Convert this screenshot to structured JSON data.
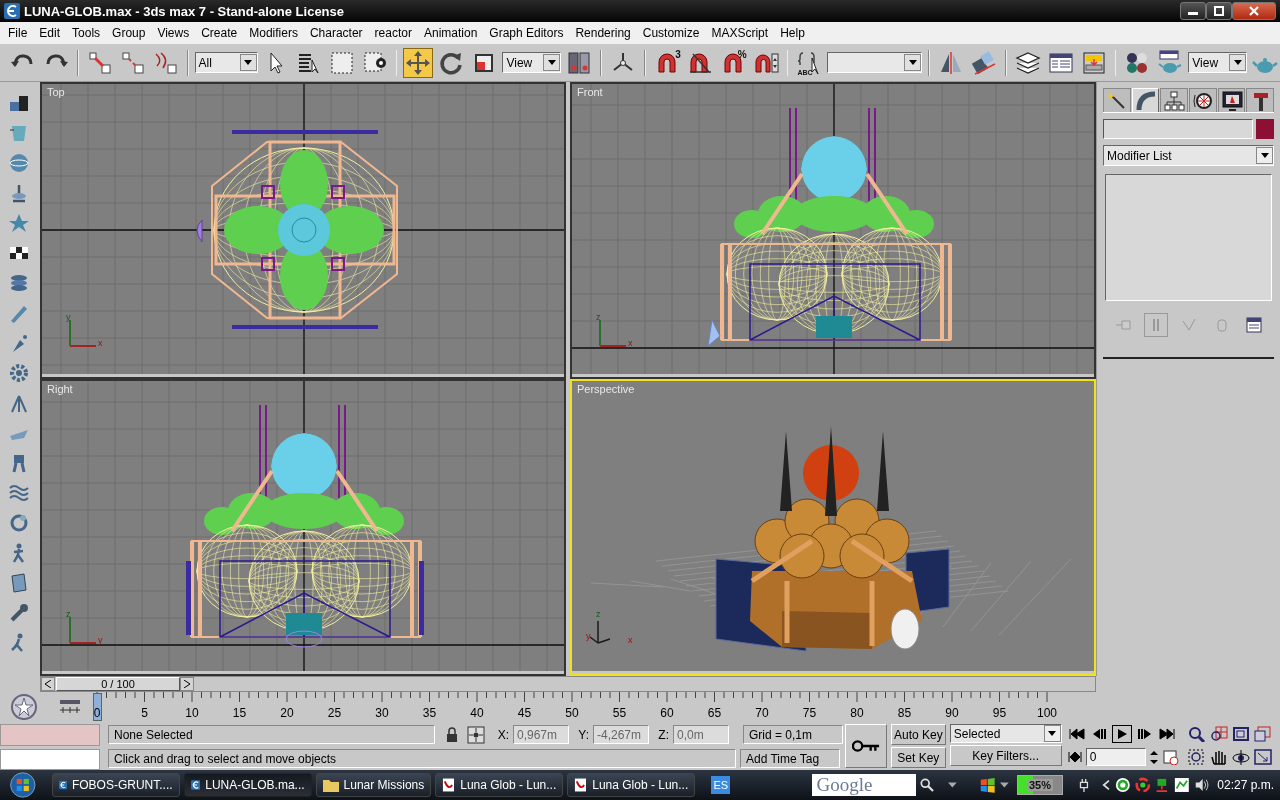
{
  "window": {
    "title": "LUNA-GLOB.max - 3ds max 7  - Stand-alone License"
  },
  "menu": [
    "File",
    "Edit",
    "Tools",
    "Group",
    "Views",
    "Create",
    "Modifiers",
    "Character",
    "reactor",
    "Animation",
    "Graph Editors",
    "Rendering",
    "Customize",
    "MAXScript",
    "Help"
  ],
  "main_toolbar": {
    "buttons": [
      {
        "selected": false
      },
      {
        "selected": false
      },
      {
        "selected": false
      },
      {
        "selected": false
      },
      {
        "selected": false
      },
      {
        "selected": false
      },
      {
        "selected": false
      },
      {
        "selected": false
      },
      {
        "selected": false
      },
      {
        "selected": true
      },
      {
        "selected": false
      },
      {
        "selected": false
      },
      {
        "selected": false
      },
      {
        "selected": false
      },
      {
        "selected": false,
        "label": "3"
      },
      {
        "selected": false
      },
      {
        "selected": false,
        "label": "%"
      },
      {
        "selected": false
      },
      {
        "selected": false,
        "label": "ABC"
      },
      {
        "selected": false
      },
      {
        "selected": false
      },
      {
        "selected": false
      },
      {
        "selected": false
      },
      {
        "selected": false
      },
      {
        "selected": false
      },
      {
        "selected": false
      },
      {
        "selected": false
      }
    ],
    "selection_filter": "All",
    "reference_coordinate_system": "View",
    "render_type": "View"
  },
  "viewports": [
    {
      "label": "Top",
      "kind": "top",
      "selected": false,
      "axis_labels": [
        "y",
        "x"
      ]
    },
    {
      "label": "Front",
      "kind": "elevation",
      "selected": false,
      "axis_labels": [
        "z",
        "x"
      ]
    },
    {
      "label": "Right",
      "kind": "elevation",
      "selected": false,
      "axis_labels": [
        "z",
        "y"
      ]
    },
    {
      "label": "Perspective",
      "kind": "shaded",
      "selected": true,
      "axis_labels": [
        "z",
        "x",
        "y"
      ]
    }
  ],
  "command_panel": {
    "tabs": [
      {
        "selected": false
      },
      {
        "selected": true
      },
      {
        "selected": false
      },
      {
        "selected": false
      },
      {
        "selected": false
      },
      {
        "selected": false
      }
    ],
    "modifier_list": "Modifier List"
  },
  "timeline": {
    "position": "0 / 100",
    "level": 0,
    "ticks": [
      "0",
      "5",
      "10",
      "15",
      "20",
      "25",
      "30",
      "35",
      "40",
      "45",
      "50",
      "55",
      "60",
      "65",
      "70",
      "75",
      "80",
      "85",
      "90",
      "95",
      "100"
    ]
  },
  "status": {
    "selection": "None Selected",
    "prompt": "Click and drag to select and move objects",
    "coords": [
      {
        "axis": "X:",
        "value": "0,967m"
      },
      {
        "axis": "Y:",
        "value": "-4,267m"
      },
      {
        "axis": "Z:",
        "value": "0,0m"
      }
    ],
    "grid": "Grid = 0,1m",
    "time_tag": "Add Time Tag",
    "auto_key": {
      "label": "Auto Key",
      "on": false
    },
    "set_key": "Set Key",
    "key_mode": "Selected",
    "key_filters": "Key Filters...",
    "frame": "0"
  },
  "taskbar": {
    "tasks": [
      {
        "label": "FOBOS-GRUNT....",
        "kind": "max",
        "selected": false
      },
      {
        "label": "LUNA-GLOB.ma...",
        "kind": "max",
        "selected": true
      },
      {
        "label": "Lunar Missions",
        "kind": "folder",
        "selected": false
      },
      {
        "label": "Luna Glob - Lun...",
        "kind": "pdf",
        "selected": false
      },
      {
        "label": "Luna Glob - Lun...",
        "kind": "pdf",
        "selected": false
      }
    ],
    "language": "ES",
    "search_placeholder": "Google",
    "battery": {
      "label": "35%",
      "level": 0.35
    },
    "clock": "02:27 p.m."
  }
}
